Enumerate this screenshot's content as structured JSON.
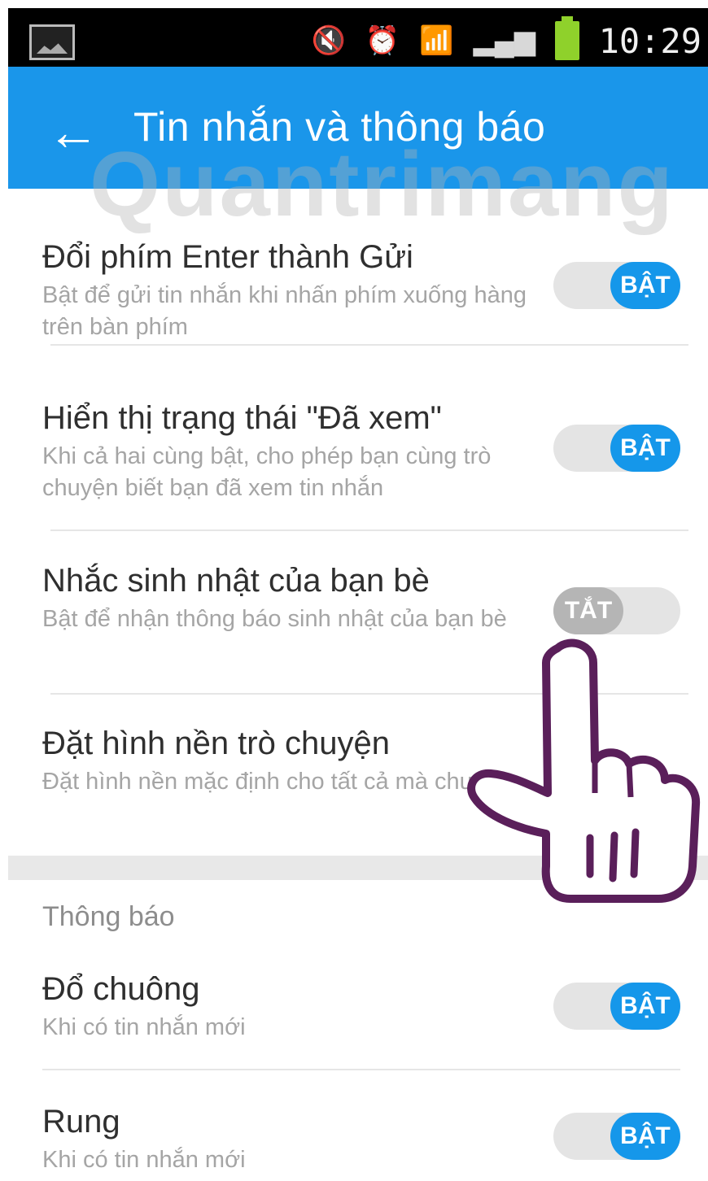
{
  "status_bar": {
    "time": "10:29",
    "icons": [
      "gallery-icon",
      "mute-icon",
      "alarm-icon",
      "wifi-icon",
      "signal-icon",
      "battery-icon"
    ]
  },
  "app_bar": {
    "title": "Tin nhắn và thông báo",
    "back_icon": "arrow-left-icon",
    "color": "#1a96ea"
  },
  "watermark": "Quantrimang",
  "settings": [
    {
      "title": "Đổi phím Enter thành Gửi",
      "desc": "Bật để gửi tin nhắn khi nhấn phím xuống hàng trên bàn phím",
      "toggle": "BẬT",
      "on": true
    },
    {
      "title": "Hiển thị trạng thái \"Đã xem\"",
      "desc": "Khi cả hai cùng bật, cho phép bạn cùng trò chuyện biết bạn đã xem tin nhắn",
      "toggle": "BẬT",
      "on": true
    },
    {
      "title": "Nhắc sinh nhật của bạn bè",
      "desc": "Bật để nhận thông báo sinh nhật của bạn bè",
      "toggle": "TẮT",
      "on": false
    },
    {
      "title": "Đặt hình nền trò chuyện",
      "desc": "Đặt hình nền mặc định cho tất cả mà chuyện"
    }
  ],
  "notifications": {
    "section_label": "Thông báo",
    "items": [
      {
        "title": "Đổ chuông",
        "desc": "Khi có tin nhắn mới",
        "toggle": "BẬT",
        "on": true
      },
      {
        "title": "Rung",
        "desc": "Khi có tin nhắn mới",
        "toggle": "BẬT",
        "on": true
      }
    ]
  },
  "accent_color": "#1597ea"
}
